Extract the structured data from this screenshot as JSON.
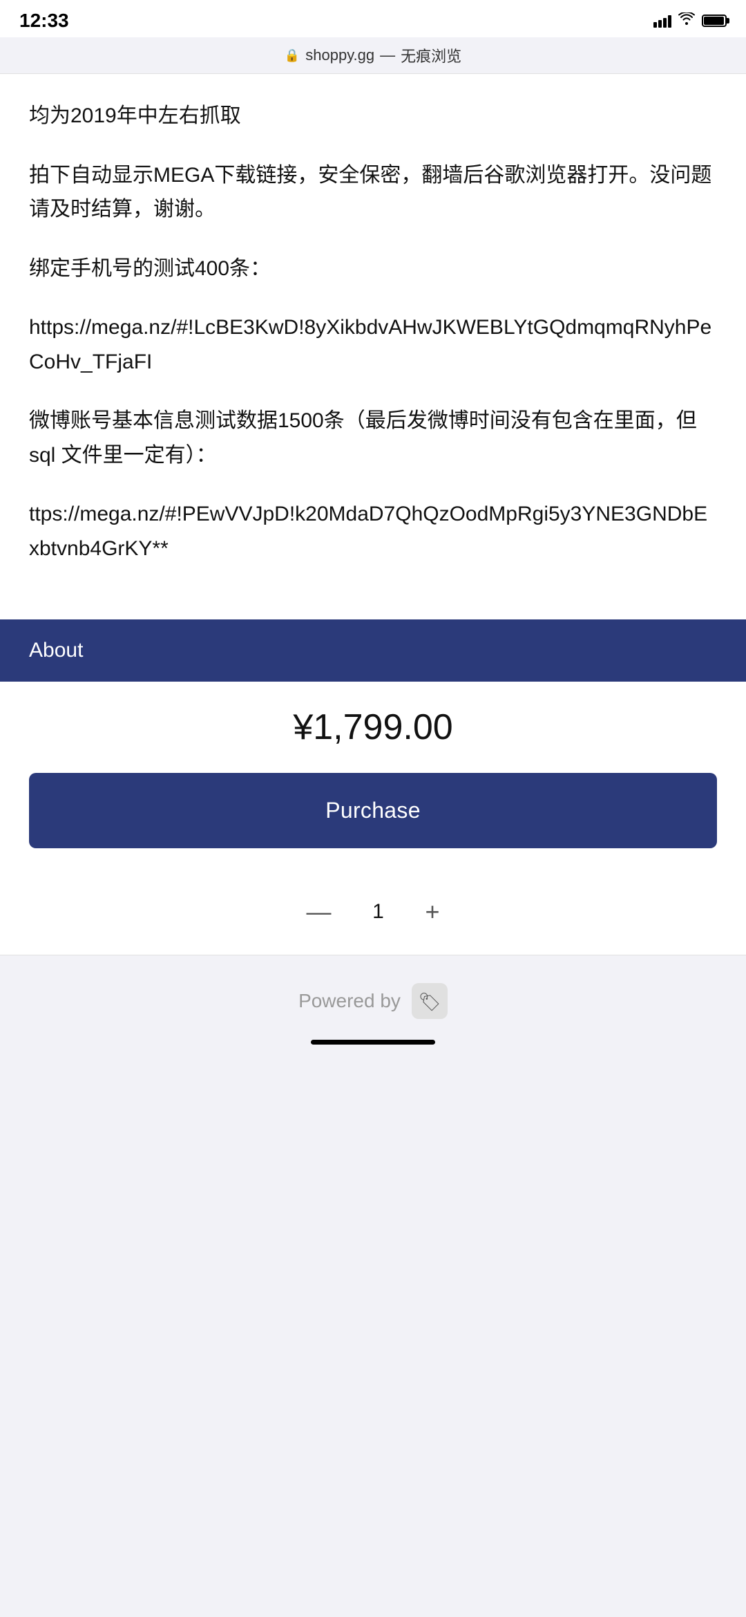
{
  "statusBar": {
    "time": "12:33"
  },
  "browserBar": {
    "url": "shoppy.gg",
    "mode": "无痕浏览",
    "separator": "—"
  },
  "content": {
    "paragraph1": "均为2019年中左右抓取",
    "paragraph2": "拍下自动显示MEGA下载链接，安全保密，翻墙后谷歌浏览器打开。没问题请及时结算，谢谢。",
    "paragraph3": "绑定手机号的测试400条：",
    "link1": "https://mega.nz/#!LcBE3KwD!8yXikbdvAHwJKWEBLYtGQdmqmqRNyhPeCoHv_TFjaFI",
    "paragraph4": "微博账号基本信息测试数据1500条（最后发微博时间没有包含在里面，但 sql 文件里一定有）：",
    "link2": "ttps://mega.nz/#!PEwVVJpD!k20MdaD7QhQzOodMpRgi5y3YNE3GNDbExbtvnb4GrKY**"
  },
  "about": {
    "label": "About"
  },
  "pricing": {
    "price": "¥1,799.00"
  },
  "purchaseButton": {
    "label": "Purchase"
  },
  "quantity": {
    "decrement": "—",
    "value": "1",
    "increment": "+"
  },
  "footer": {
    "poweredBy": "Powered by"
  }
}
